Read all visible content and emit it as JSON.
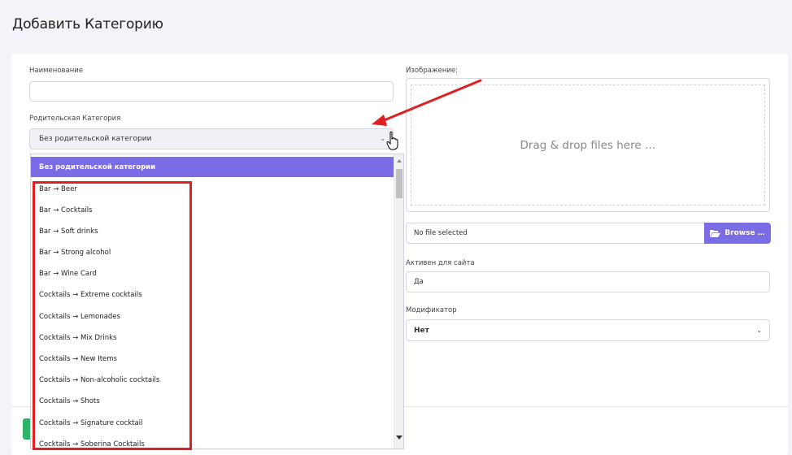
{
  "page": {
    "title": "Добавить Категорию"
  },
  "form": {
    "name_label": "Наименование",
    "name_value": "",
    "parent_label": "Родительская Категория",
    "parent_selected": "Без родительской категории",
    "parent_options": [
      "Без родительской категории",
      "Bar → Beer",
      "Bar → Cocktails",
      "Bar → Soft drinks",
      "Bar → Strong alcohol",
      "Bar → Wine Card",
      "Cocktails → Extreme cocktails",
      "Cocktails → Lemonades",
      "Cocktails → Mix Drinks",
      "Cocktails → New Items",
      "Cocktails → Non-alcoholic cocktails",
      "Cocktails → Shots",
      "Cocktails → Signature cocktail",
      "Cocktails → Soberina Cocktails"
    ],
    "image_label": "Изображение:",
    "dropzone_text": "Drag & drop files here …",
    "file_status": "No file selected",
    "browse_label": "Browse …",
    "active_label": "Активен для сайта",
    "active_value": "Да",
    "modifier_label": "Модификатор",
    "modifier_selected": "Нет"
  },
  "colors": {
    "accent": "#7a6ce4",
    "annotation": "#e02020",
    "save": "#2cb56a"
  },
  "icons": [
    "chevron-down-icon",
    "folder-open-icon",
    "hand-pointer-icon",
    "arrow-annotation"
  ]
}
